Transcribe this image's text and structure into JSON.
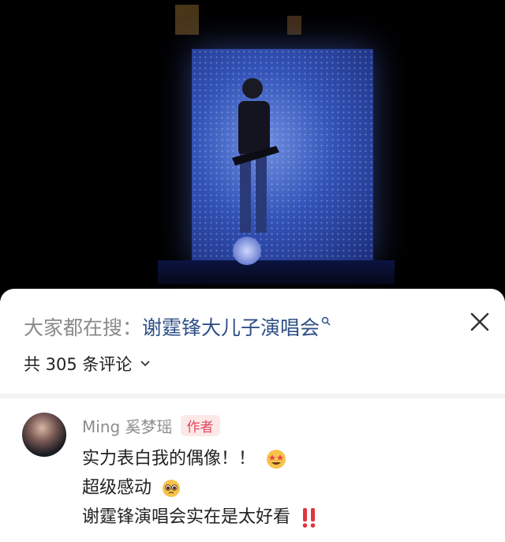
{
  "search": {
    "prefix": "大家都在搜：",
    "query": "谢霆锋大儿子演唱会"
  },
  "comments": {
    "count_label": "共 305 条评论"
  },
  "comment": {
    "author": "Ming 奚梦瑶",
    "badge": "作者",
    "lines": [
      "实力表白我的偶像！！",
      "超级感动",
      "谢霆锋演唱会实在是太好看"
    ]
  },
  "icons": {
    "close": "close-icon",
    "search": "search-icon",
    "chevron": "chevron-down-icon",
    "star_eyes": "star-struck-emoji-icon",
    "teary": "pleading-face-emoji-icon",
    "exclaim": "double-exclamation-icon"
  },
  "colors": {
    "link": "#2e4f86",
    "badge_bg": "#fde8e8",
    "badge_text": "#e0485a"
  }
}
